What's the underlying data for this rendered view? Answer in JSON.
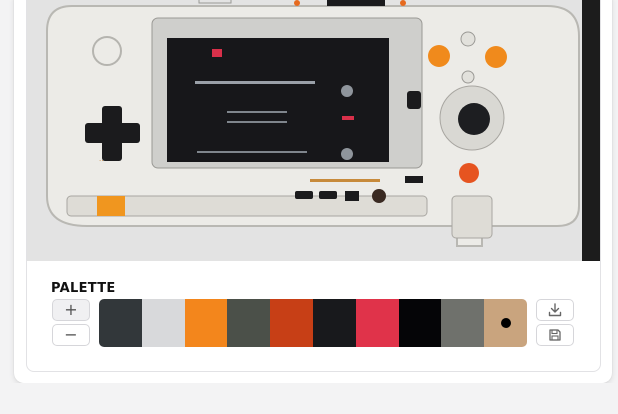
{
  "palette": {
    "title": "PALETTE",
    "add_label": "+",
    "remove_label": "−",
    "swatches": [
      {
        "color": "#32373a"
      },
      {
        "color": "#d8d9db"
      },
      {
        "color": "#f3861c"
      },
      {
        "color": "#4b5049"
      },
      {
        "color": "#c73f16"
      },
      {
        "color": "#18191c"
      },
      {
        "color": "#e0334a"
      },
      {
        "color": "#050507"
      },
      {
        "color": "#6f716c"
      },
      {
        "color": "#c9a47e",
        "selected": true
      }
    ],
    "icons": {
      "add": "plus-icon",
      "remove": "minus-icon",
      "download": "download-icon",
      "save": "save-icon"
    }
  },
  "image": {
    "subject": "handheld-console-photo"
  }
}
